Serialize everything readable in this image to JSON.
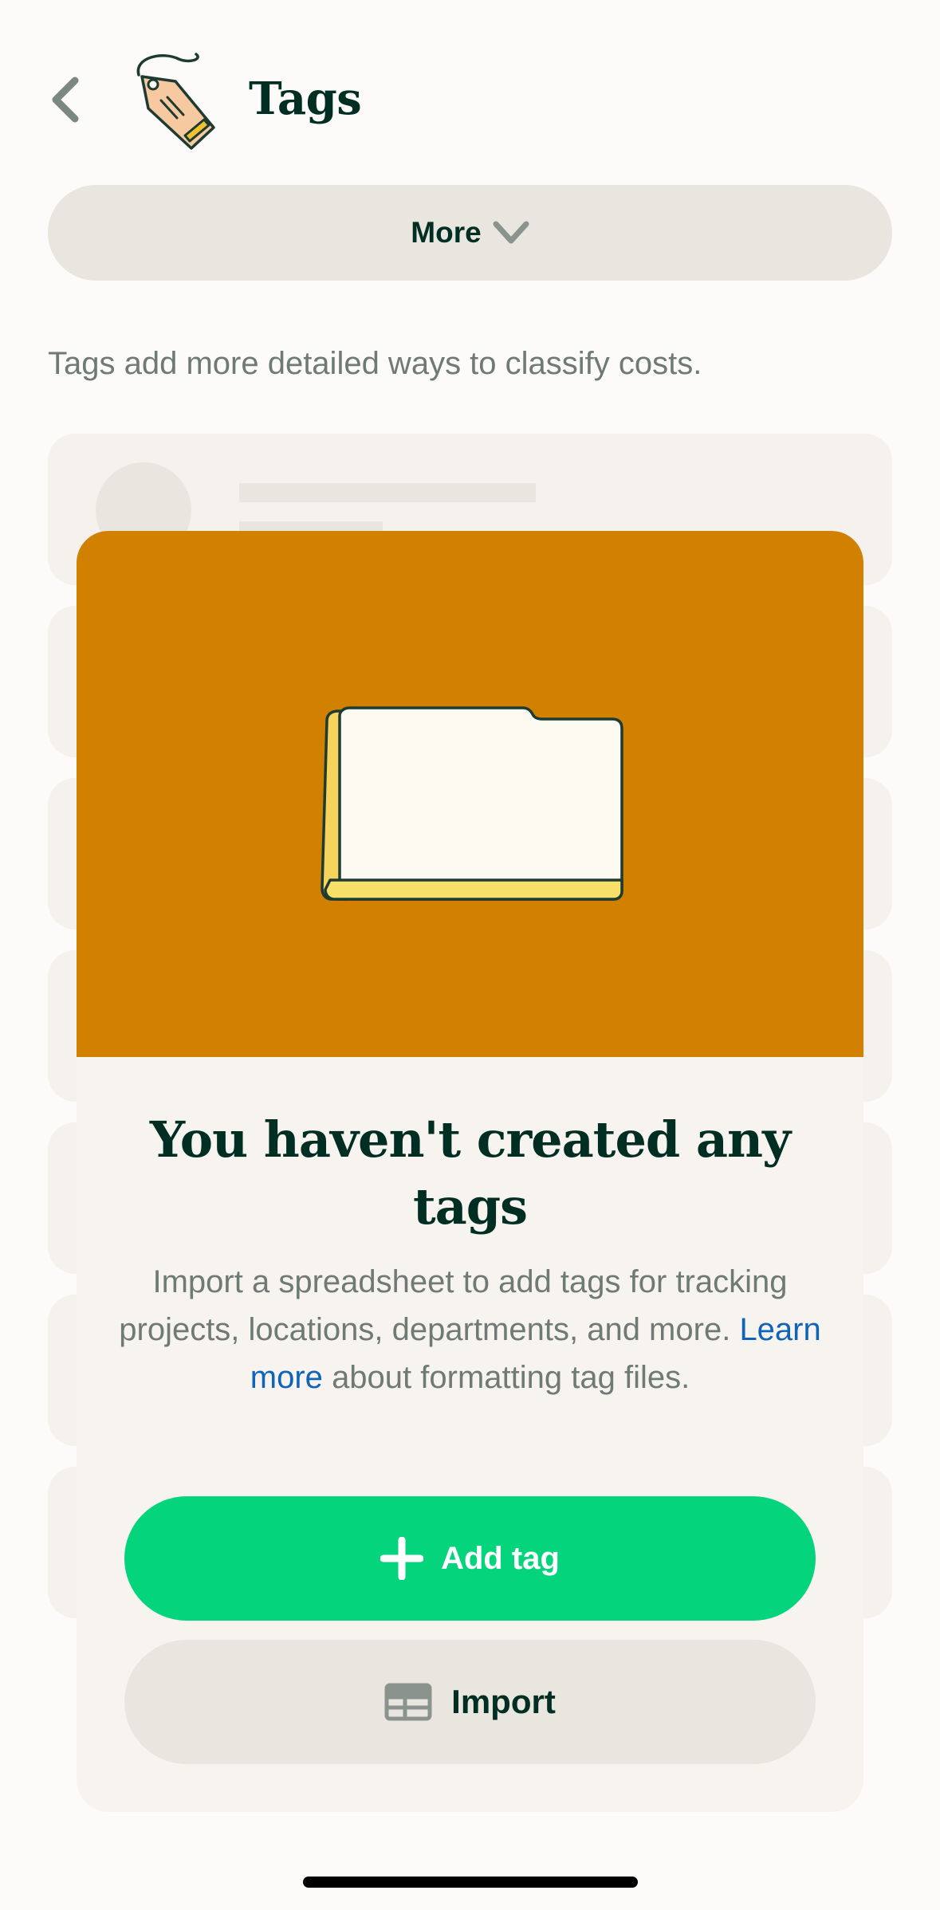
{
  "header": {
    "title": "Tags"
  },
  "more_button": {
    "label": "More"
  },
  "description": "Tags add more detailed ways to classify costs.",
  "empty_state": {
    "title": "You haven't created any tags",
    "body_before_link": "Import a spreadsheet to add tags for tracking projects, locations, departments, and more.",
    "link_text": "Learn more",
    "body_after_link": "about formatting tag files."
  },
  "actions": {
    "add_label": "Add tag",
    "import_label": "Import"
  },
  "icons": {
    "back": "chevron-left-icon",
    "tag": "price-tag-icon",
    "more": "chevron-down-icon",
    "folder": "folder-icon",
    "add": "plus-icon",
    "import": "table-icon"
  },
  "colors": {
    "background": "#fcfbf9",
    "primary_text": "#002e22",
    "muted_text": "#6f7a74",
    "hero": "#d18000",
    "add_button": "#04d47c",
    "secondary_button": "#e9e5df",
    "link": "#0f63b8"
  }
}
